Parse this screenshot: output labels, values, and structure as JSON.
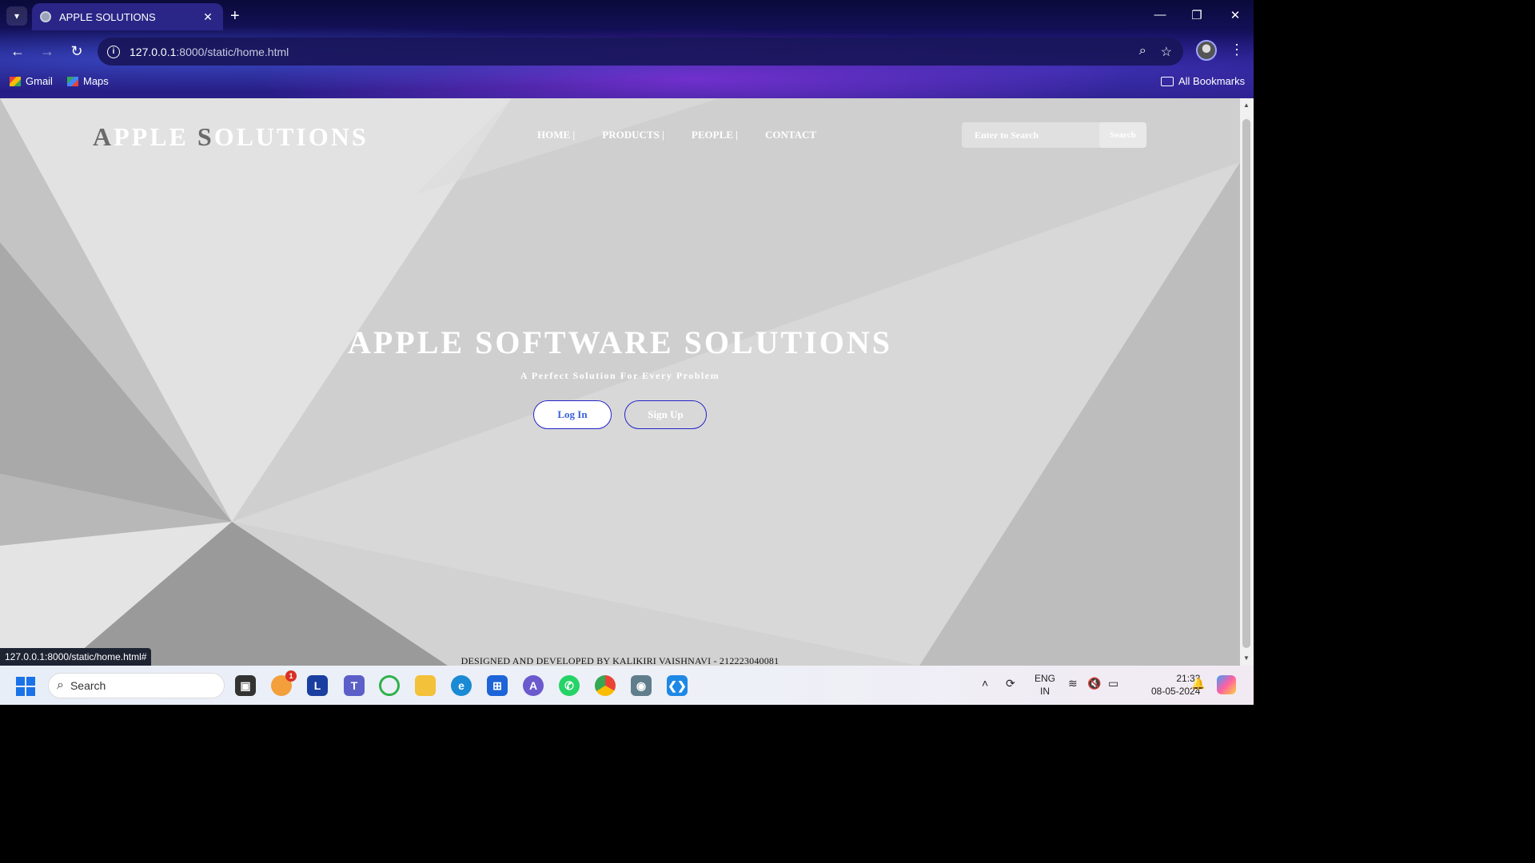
{
  "browser": {
    "tab_title": "APPLE SOLUTIONS",
    "url_host": "127.0.0.1",
    "url_path": ":8000/static/home.html",
    "bookmarks": [
      "Gmail",
      "Maps"
    ],
    "all_bookmarks": "All Bookmarks",
    "status_url": "127.0.0.1:8000/static/home.html#"
  },
  "site": {
    "logo_first": "A",
    "logo_mid": "PPLE ",
    "logo_s": "S",
    "logo_rest": "OLUTIONS",
    "nav": [
      "HOME |",
      "PRODUCTS |",
      "PEOPLE |",
      "CONTACT"
    ],
    "search_placeholder": "Enter to Search",
    "search_button": "Search",
    "hero_title": "APPLE SOFTWARE SOLUTIONS",
    "hero_subtitle": "A Perfect Solution For Every Problem",
    "login_label": "Log In",
    "signup_label": "Sign Up",
    "footer": "DESIGNED AND DEVELOPED BY KALIKIRI VAISHNAVI - 212223040081"
  },
  "taskbar": {
    "search_label": "Search",
    "notification_count": "1",
    "language": "ENG",
    "region": "IN",
    "time": "21:33",
    "date": "08-05-2024"
  }
}
